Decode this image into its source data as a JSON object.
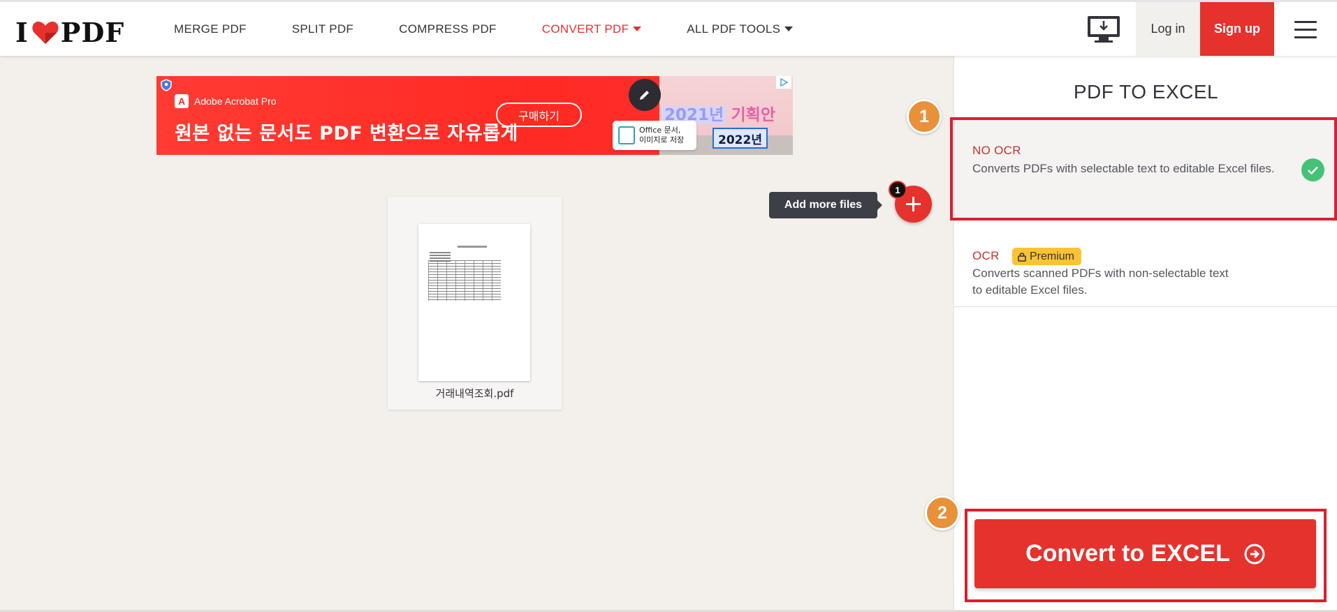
{
  "header": {
    "logo_left": "I",
    "logo_right": "PDF",
    "nav": [
      {
        "label": "MERGE PDF",
        "active": false,
        "dropdown": false
      },
      {
        "label": "SPLIT PDF",
        "active": false,
        "dropdown": false
      },
      {
        "label": "COMPRESS PDF",
        "active": false,
        "dropdown": false
      },
      {
        "label": "CONVERT PDF",
        "active": true,
        "dropdown": true
      },
      {
        "label": "ALL PDF TOOLS",
        "active": false,
        "dropdown": true
      }
    ],
    "login": "Log in",
    "signup": "Sign up",
    "icons": {
      "desktop": "desktop-download-icon",
      "menu": "hamburger-menu-icon"
    }
  },
  "ad": {
    "brand": "Adobe Acrobat Pro",
    "headline": "원본 없는 문서도 PDF 변환으로 자유롭게",
    "buy": "구매하기",
    "year_a": "2021년",
    "year_b": "기획안",
    "office_line1": "Office 문서,",
    "office_line2": "이미지로 저장",
    "year_box": "2022년"
  },
  "file": {
    "name": "거래내역조회.pdf"
  },
  "add_files": {
    "tooltip": "Add more files",
    "count": "1"
  },
  "steps": [
    "1",
    "2"
  ],
  "sidebar": {
    "title": "PDF TO EXCEL",
    "options": [
      {
        "label": "NO OCR",
        "desc": "Converts PDFs with selectable text to editable Excel files.",
        "selected": true
      },
      {
        "label": "OCR",
        "badge": "Premium",
        "desc": "Converts scanned PDFs with non-selectable text to editable Excel files.",
        "selected": false
      }
    ],
    "convert": "Convert to EXCEL"
  },
  "colors": {
    "brand_red": "#e5322d",
    "highlight_red": "#dd1e2e",
    "step_orange": "#e8913a",
    "check_green": "#45c276",
    "premium_yellow": "#fac333"
  }
}
